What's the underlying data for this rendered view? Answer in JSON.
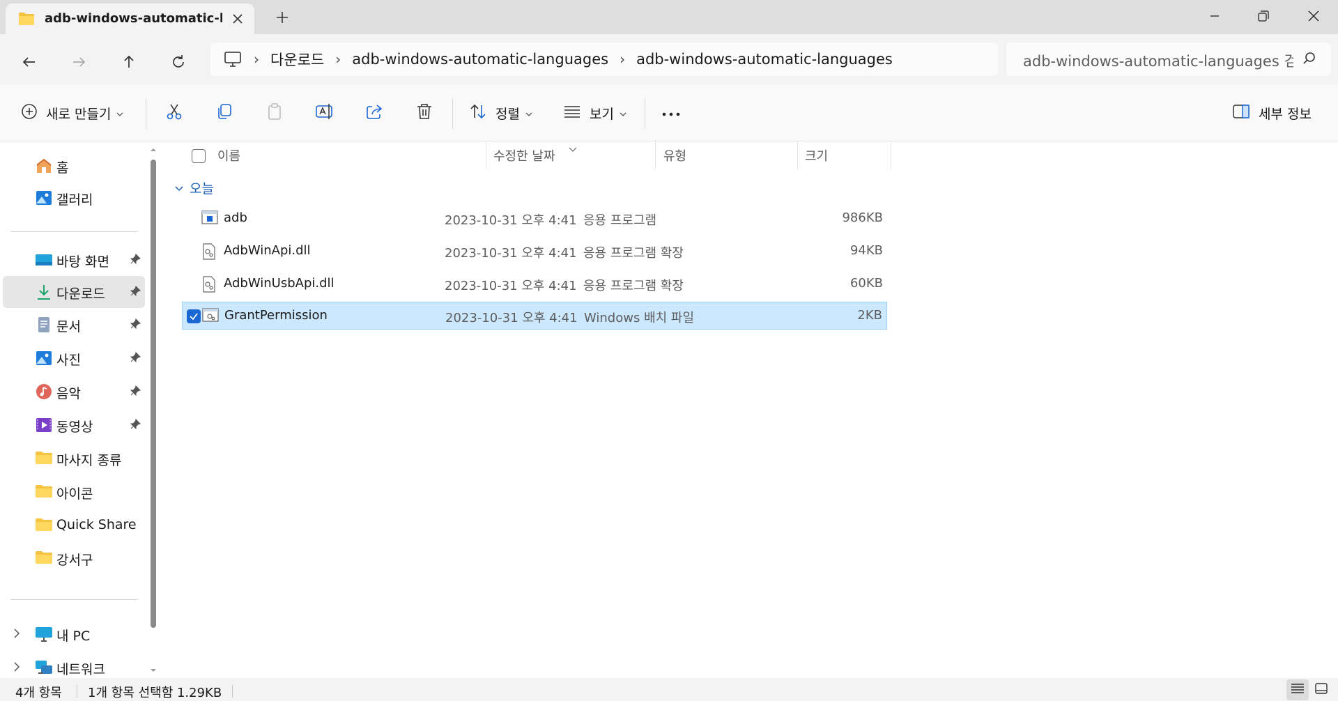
{
  "window": {
    "tab_title": "adb-windows-automatic-languages",
    "icons": {
      "tab": "folder-icon",
      "close_tab": "close-icon",
      "new_tab": "plus-icon"
    },
    "controls": [
      "minimize-icon",
      "maximize-icon",
      "close-icon"
    ]
  },
  "navigation": {
    "buttons": [
      "back-arrow-icon",
      "forward-arrow-icon",
      "up-arrow-icon",
      "refresh-icon"
    ],
    "breadcrumb": [
      "다운로드",
      "adb-windows-automatic-languages",
      "adb-windows-automatic-languages"
    ],
    "search_placeholder": "adb-windows-automatic-languages 검색"
  },
  "commandbar": {
    "new_label": "새로 만들기",
    "sort_label": "정렬",
    "view_label": "보기",
    "details_label": "세부 정보",
    "icons": [
      "add-circle-icon",
      "cut-icon",
      "copy-icon",
      "paste-icon",
      "rename-icon",
      "share-icon",
      "delete-icon",
      "sort-icon",
      "view-icon",
      "more-icon",
      "details-pane-icon"
    ]
  },
  "sidebar": {
    "top": [
      {
        "label": "홈",
        "icon": "home-icon"
      },
      {
        "label": "갤러리",
        "icon": "gallery-icon"
      }
    ],
    "pinned": [
      {
        "label": "바탕 화면",
        "icon": "desktop-icon",
        "pinned": true
      },
      {
        "label": "다운로드",
        "icon": "download-icon",
        "pinned": true,
        "selected": true
      },
      {
        "label": "문서",
        "icon": "document-icon",
        "pinned": true
      },
      {
        "label": "사진",
        "icon": "pictures-icon",
        "pinned": true
      },
      {
        "label": "음악",
        "icon": "music-icon",
        "pinned": true
      },
      {
        "label": "동영상",
        "icon": "videos-icon",
        "pinned": true
      },
      {
        "label": "마사지 종류",
        "icon": "folder-icon"
      },
      {
        "label": "아이콘",
        "icon": "folder-icon"
      },
      {
        "label": "Quick Share",
        "icon": "folder-icon"
      },
      {
        "label": "강서구",
        "icon": "folder-icon"
      }
    ],
    "bottom": [
      {
        "label": "내 PC",
        "icon": "pc-icon"
      },
      {
        "label": "네트워크",
        "icon": "network-icon"
      }
    ]
  },
  "columns": {
    "name": "이름",
    "modified": "수정한 날짜",
    "type": "유형",
    "size": "크기"
  },
  "group_label": "오늘",
  "files": [
    {
      "name": "adb",
      "modified": "2023-10-31 오후 4:41",
      "type": "응용 프로그램",
      "size": "986KB",
      "icon": "application-icon",
      "selected": false
    },
    {
      "name": "AdbWinApi.dll",
      "modified": "2023-10-31 오후 4:41",
      "type": "응용 프로그램 확장",
      "size": "94KB",
      "icon": "dll-file-icon",
      "selected": false
    },
    {
      "name": "AdbWinUsbApi.dll",
      "modified": "2023-10-31 오후 4:41",
      "type": "응용 프로그램 확장",
      "size": "60KB",
      "icon": "dll-file-icon",
      "selected": false
    },
    {
      "name": "GrantPermission",
      "modified": "2023-10-31 오후 4:41",
      "type": "Windows 배치 파일",
      "size": "2KB",
      "icon": "batch-file-icon",
      "selected": true
    }
  ],
  "status": {
    "item_count": "4개 항목",
    "selection": "1개 항목 선택함 1.29KB"
  },
  "colors": {
    "accent": "#1a66d2",
    "selection_bg": "#cce8ff",
    "selection_border": "#99d1ff",
    "group_text": "#1a5fb4"
  }
}
